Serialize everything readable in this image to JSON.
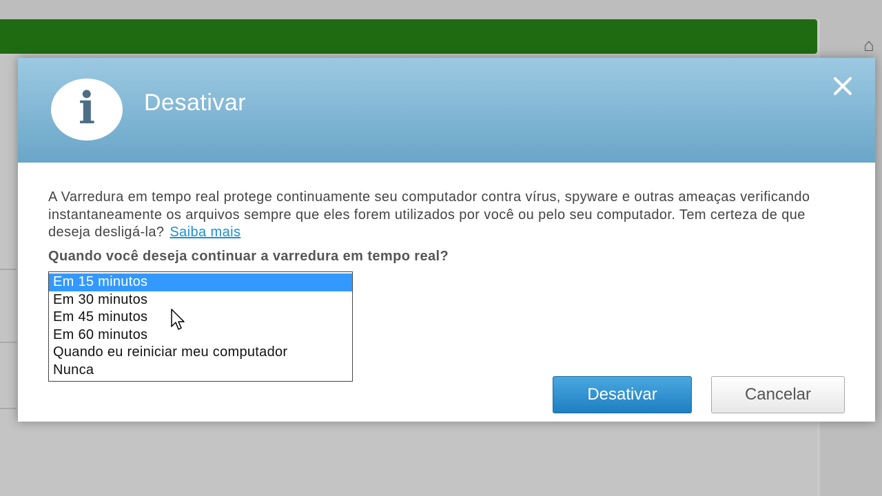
{
  "dialog": {
    "title": "Desativar",
    "icon": "info-icon",
    "close_icon": "close-icon",
    "body": "A Varredura em tempo real protege continuamente seu computador contra vírus, spyware e outras ameaças verificando instantaneamente os arquivos sempre que eles forem utilizados por você ou pelo seu computador. Tem certeza de que deseja desligá-la?",
    "link_label": "Saiba mais",
    "question": "Quando você deseja continuar a varredura em tempo real?",
    "options": [
      "Em 15 minutos",
      "Em 30 minutos",
      "Em 45 minutos",
      "Em 60 minutos",
      "Quando eu reiniciar meu computador",
      "Nunca"
    ],
    "selected_index": 0,
    "primary_button": "Desativar",
    "secondary_button": "Cancelar"
  },
  "colors": {
    "header_top": "#9cc9e2",
    "header_bottom": "#6aa6c8",
    "selection": "#3399ff",
    "link": "#1a8ed6",
    "primary_button": "#1e7fc2"
  }
}
